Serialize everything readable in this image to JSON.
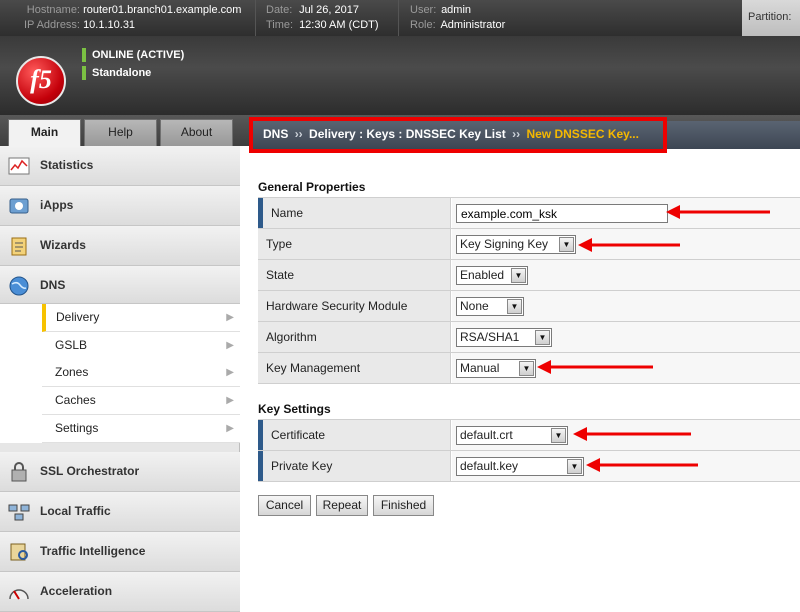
{
  "topbar": {
    "hostname_label": "Hostname:",
    "hostname": "router01.branch01.example.com",
    "ip_label": "IP Address:",
    "ip": "10.1.10.31",
    "date_label": "Date:",
    "date": "Jul 26, 2017",
    "time_label": "Time:",
    "time": "12:30 AM (CDT)",
    "user_label": "User:",
    "user": "admin",
    "role_label": "Role:",
    "role": "Administrator",
    "partition_label": "Partition:"
  },
  "header": {
    "logo": "f5",
    "status": "ONLINE (ACTIVE)",
    "mode": "Standalone"
  },
  "tabs": [
    "Main",
    "Help",
    "About"
  ],
  "nav": {
    "statistics": "Statistics",
    "iapps": "iApps",
    "wizards": "Wizards",
    "dns": "DNS",
    "dns_sub": [
      "Delivery",
      "GSLB",
      "Zones",
      "Caches",
      "Settings"
    ],
    "ssl": "SSL Orchestrator",
    "local_traffic": "Local Traffic",
    "traffic_intel": "Traffic Intelligence",
    "acceleration": "Acceleration"
  },
  "breadcrumb": {
    "parts": [
      "DNS",
      "Delivery : Keys : DNSSEC Key List"
    ],
    "current": "New DNSSEC Key...",
    "sep": "››"
  },
  "general": {
    "title": "General Properties",
    "name_label": "Name",
    "name_value": "example.com_ksk",
    "type_label": "Type",
    "type_value": "Key Signing Key",
    "state_label": "State",
    "state_value": "Enabled",
    "hsm_label": "Hardware Security Module",
    "hsm_value": "None",
    "algo_label": "Algorithm",
    "algo_value": "RSA/SHA1",
    "km_label": "Key Management",
    "km_value": "Manual"
  },
  "keysettings": {
    "title": "Key Settings",
    "cert_label": "Certificate",
    "cert_value": "default.crt",
    "pk_label": "Private Key",
    "pk_value": "default.key"
  },
  "buttons": {
    "cancel": "Cancel",
    "repeat": "Repeat",
    "finished": "Finished"
  },
  "colors": {
    "accent": "#f7c200",
    "annotation": "#ee0000",
    "required_marker": "#2e5a8a"
  }
}
